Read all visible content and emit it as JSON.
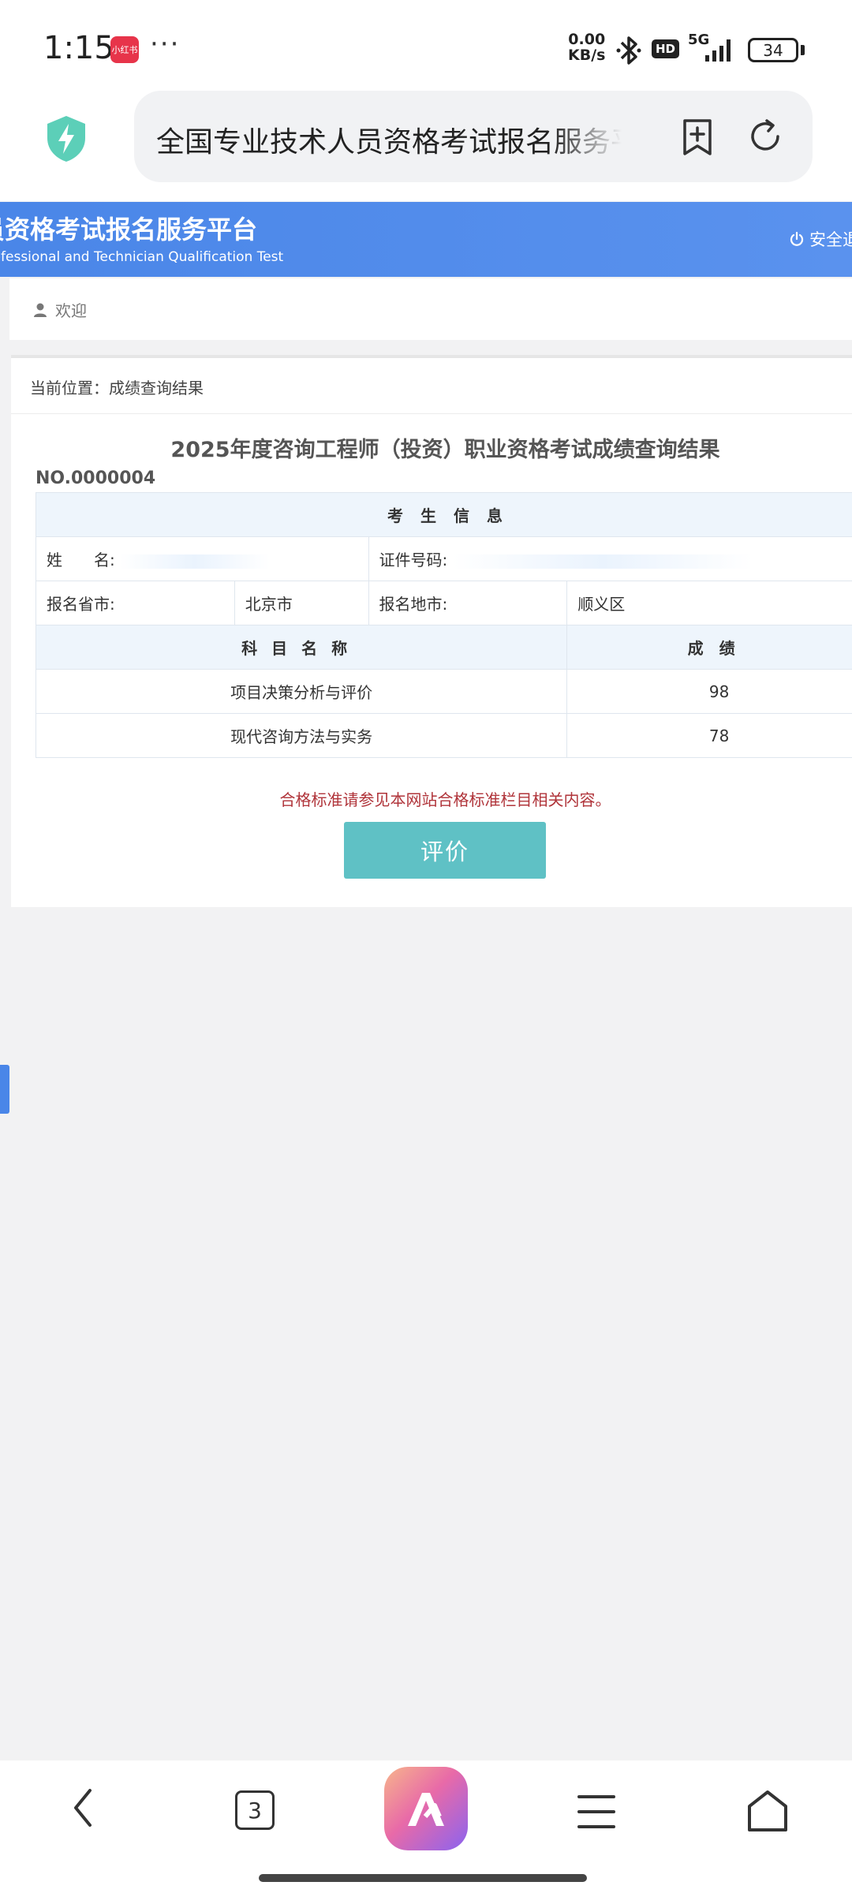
{
  "status_bar": {
    "time": "1:15",
    "app_badge": "小红书",
    "dots": "···",
    "net_speed_value": "0.00",
    "net_speed_unit": "KB/s",
    "hd": "HD",
    "signal_label": "5G",
    "battery": "34"
  },
  "browser": {
    "url_title": "全国专业技术人员资格考试报名服务平台"
  },
  "site": {
    "title": "员资格考试报名服务平台",
    "subtitle": "rofessional and Technician Qualification Test",
    "logout": "安全退出",
    "welcome": "欢迎"
  },
  "content": {
    "breadcrumb": "当前位置：成绩查询结果",
    "title": "2025年度咨询工程师（投资）职业资格考试成绩查询结果",
    "cert_no": "NO.0000004",
    "section_head": "考生信息",
    "name_label": "姓　　名:",
    "id_label": "证件号码:",
    "province_label": "报名省市:",
    "province_value": "北京市",
    "area_label": "报名地市:",
    "area_value": "顺义区",
    "subject_head": "科目名称",
    "score_head": "成绩",
    "subjects": [
      {
        "name": "项目决策分析与评价",
        "score": "98"
      },
      {
        "name": "现代咨询方法与实务",
        "score": "78"
      }
    ],
    "pass_note": "合格标准请参见本网站合格标准栏目相关内容。",
    "rate_button": "评价"
  },
  "bottom_nav": {
    "tabs_count": "3"
  },
  "colors": {
    "header_blue": "#4a86e8",
    "button_teal": "#5fc1c5",
    "note_red": "#b0343a"
  }
}
